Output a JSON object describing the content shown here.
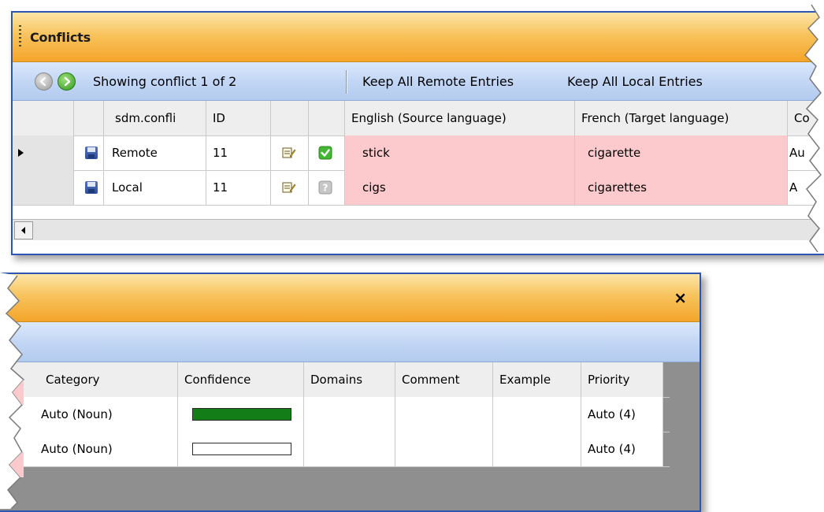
{
  "top": {
    "title": "Conflicts",
    "showing": "Showing conflict 1 of 2",
    "keep_remote": "Keep All Remote Entries",
    "keep_local": "Keep All Local Entries",
    "columns": [
      "sdm.confli",
      "ID",
      "English (Source language)",
      "French (Target language)",
      "Co"
    ],
    "rows": [
      {
        "type": "Remote",
        "id": "11",
        "source": "stick",
        "target": "cigarette",
        "extra": "Au",
        "selected": true,
        "status": "accepted"
      },
      {
        "type": "Local",
        "id": "11",
        "source": "cigs",
        "target": "cigarettes",
        "extra": "A",
        "selected": false,
        "status": "unknown"
      }
    ]
  },
  "bottom": {
    "close": "×",
    "columns": [
      "Category",
      "Confidence",
      "Domains",
      "Comment",
      "Example",
      "Priority"
    ],
    "rows": [
      {
        "category": "Auto (Noun)",
        "confidence": 1.0,
        "domains": "",
        "comment": "",
        "example": "",
        "priority": "Auto (4)"
      },
      {
        "category": "Auto (Noun)",
        "confidence": 0.0,
        "domains": "",
        "comment": "",
        "example": "",
        "priority": "Auto (4)"
      }
    ]
  },
  "colors": {
    "accent_orange": "#f4a52a",
    "toolbar_blue": "#c3d7f5",
    "border_blue": "#2d56b0",
    "conflict_pink": "#fcc9cc",
    "confidence_green": "#137d17"
  }
}
